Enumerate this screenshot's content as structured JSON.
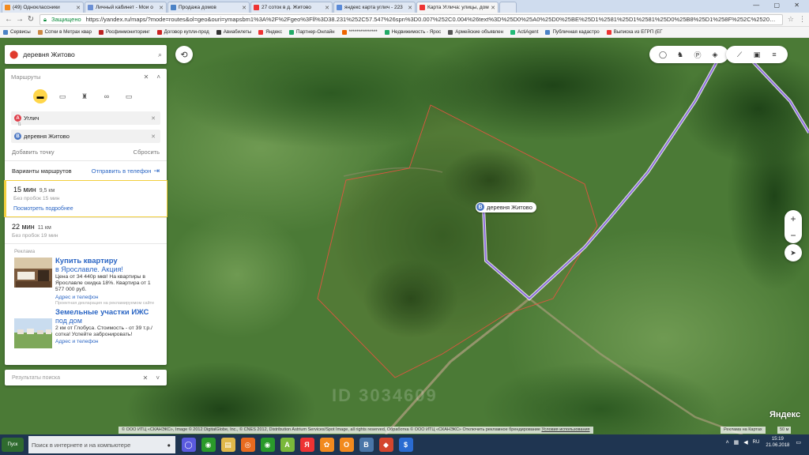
{
  "browser": {
    "tabs": [
      {
        "label": "(49) Одноклассники",
        "color": "#f28a1e"
      },
      {
        "label": "Личный кабинет - Мои о",
        "color": "#6b8fd4"
      },
      {
        "label": "Продажа домов",
        "color": "#4b82c6"
      },
      {
        "label": "27 соток в д. Житово",
        "color": "#e33"
      },
      {
        "label": "яндекс карта углич - 223",
        "color": "#5a8ad8"
      },
      {
        "label": "Карта Углича: улицы, дом",
        "color": "#e33"
      }
    ],
    "window_controls": "— ▢ ✕",
    "secure_label": "Защищено",
    "url": "https://yandex.ru/maps/?mode=routes&ol=geo&ouri=ymapsbm1%3A%2F%2Fgeo%3Fll%3D38.231%252C57.547%26spn%3D0.007%252C0.004%26text%3D%25D0%25A0%25D0%25BE%25D1%2581%25D1%2581%25D0%25B8%25D1%258F%252C%2520%25D0%25AF",
    "bookmarks": [
      {
        "label": "Сервисы",
        "color": "#4b82c6"
      },
      {
        "label": "Сотки в Метрах квар",
        "color": "#c84"
      },
      {
        "label": "Росфинмониторинг",
        "color": "#b22"
      },
      {
        "label": "Договор купли-прод",
        "color": "#c22"
      },
      {
        "label": "Авиабилеты",
        "color": "#333"
      },
      {
        "label": "Яндекс",
        "color": "#e33"
      },
      {
        "label": "Партнер-Онлайн",
        "color": "#2a6"
      },
      {
        "label": "***************",
        "color": "#e60"
      },
      {
        "label": "Недвижимость - Ярос",
        "color": "#2a6"
      },
      {
        "label": "Армейские объявлен",
        "color": "#555"
      },
      {
        "label": "ActiAgent",
        "color": "#2b7"
      },
      {
        "label": "Публичная кадастро",
        "color": "#4b82c6"
      },
      {
        "label": "Выписка из ЕГРП (ЕГ",
        "color": "#e33"
      }
    ]
  },
  "search": {
    "query": "деревня Житово"
  },
  "routes_panel": {
    "header": "Маршруты",
    "waypoint_a": {
      "letter": "A",
      "value": "Углич"
    },
    "swap_symbol": "⇅",
    "waypoint_b": {
      "letter": "B",
      "value": "деревня Житово"
    },
    "add_point": "Добавить точку",
    "reset": "Сбросить",
    "variants_label": "Варианты маршрутов",
    "send_to_phone": "Отправить в телефон",
    "routes": [
      {
        "time": "15 мин",
        "distance": "9,5 км",
        "traffic": "Без пробок 15 мин",
        "details": "Посмотреть подробнее"
      },
      {
        "time": "22 мин",
        "distance": "11 км",
        "traffic": "Без пробок 19 мин"
      }
    ]
  },
  "ads": {
    "header": "Реклама",
    "items": [
      {
        "title": "Купить квартиру",
        "title2": "в Ярославле. Акция!",
        "body": "Цена от 34 440р мкв! На квартиры в Ярославле скидка 18%. Квартира от 1 577 000 руб.",
        "link": "Адрес и телефон",
        "note": "Проектная декларация на рекламируемом сайте"
      },
      {
        "title": "Земельные участки ИЖС",
        "title2": "под дом",
        "body": "2 км от Глобуса. Стоимость - от 39 т.р./сотка! Успейте забронировать!",
        "link": "Адрес и телефон"
      }
    ]
  },
  "results_panel": {
    "label": "Результаты поиска"
  },
  "map": {
    "place_label": "деревня Житово",
    "place_letter": "B",
    "watermark": "ID 3034609",
    "copyright": "© ООО ИТЦ «СКАНЭКС», Image © 2012 DigitalGlobe, Inc., © CNES 2012, Distribution Astrium Services/Spot Image, all rights reserved, Обработка © ООО ИТЦ «СКАНЭКС» Отключить рекламное брендирование",
    "terms": "Условия использования",
    "ads_on_map": "Реклама на Картах",
    "scale": "50 м",
    "logo": "Яндекс",
    "colors": {
      "route": "#8f6ee0",
      "boundary": "#e05540",
      "field": "#3e6b2e"
    }
  },
  "taskbar": {
    "start_label": "Пуск",
    "search_placeholder": "Поиск в интернете и на компьютере",
    "apps": [
      {
        "glyph": "◯",
        "color": "#5a5adf"
      },
      {
        "glyph": "◉",
        "color": "#2a9a2a"
      },
      {
        "glyph": "▤",
        "color": "#e0b84a"
      },
      {
        "glyph": "◎",
        "color": "#e86b1f"
      },
      {
        "glyph": "◉",
        "color": "#2a9a2a"
      },
      {
        "glyph": "A",
        "color": "#7ab83a"
      },
      {
        "glyph": "Я",
        "color": "#e33"
      },
      {
        "glyph": "✿",
        "color": "#f28a1e"
      },
      {
        "glyph": "О",
        "color": "#f28a1e"
      },
      {
        "glyph": "В",
        "color": "#4a76a8"
      },
      {
        "glyph": "◆",
        "color": "#d4462e"
      },
      {
        "glyph": "$",
        "color": "#2a6bd1"
      }
    ],
    "lang": "RU",
    "time": "15:19",
    "date": "21.06.2018"
  }
}
